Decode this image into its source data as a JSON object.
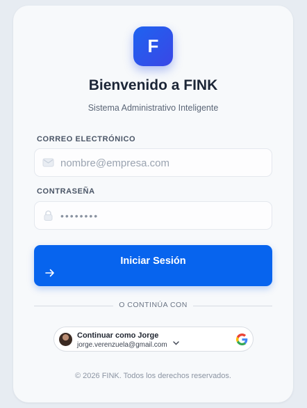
{
  "app": {
    "logo_letter": "F",
    "title": "Bienvenido a FINK",
    "subtitle": "Sistema Administrativo Inteligente"
  },
  "form": {
    "email_label": "CORREO ELECTRÓNICO",
    "email_placeholder": "nombre@empresa.com",
    "password_label": "CONTRASEÑA",
    "password_value": "••••••••",
    "submit_label": "Iniciar Sesión",
    "email_icon": "envelope-icon",
    "password_icon": "lock-icon",
    "submit_icon": "arrow-right-icon"
  },
  "divider": {
    "text": "O CONTINÚA CON"
  },
  "google_account": {
    "name": "Continuar como Jorge",
    "email": "jorge.verenzuela@gmail.com",
    "icons": [
      "avatar",
      "chevron-down-icon",
      "google-logo-icon"
    ]
  },
  "footer": {
    "text": "© 2026 FINK. Todos los derechos reservados."
  },
  "colors": {
    "primary": "#0764ee",
    "background": "#e7ecf2",
    "card": "#f7f9fb"
  }
}
